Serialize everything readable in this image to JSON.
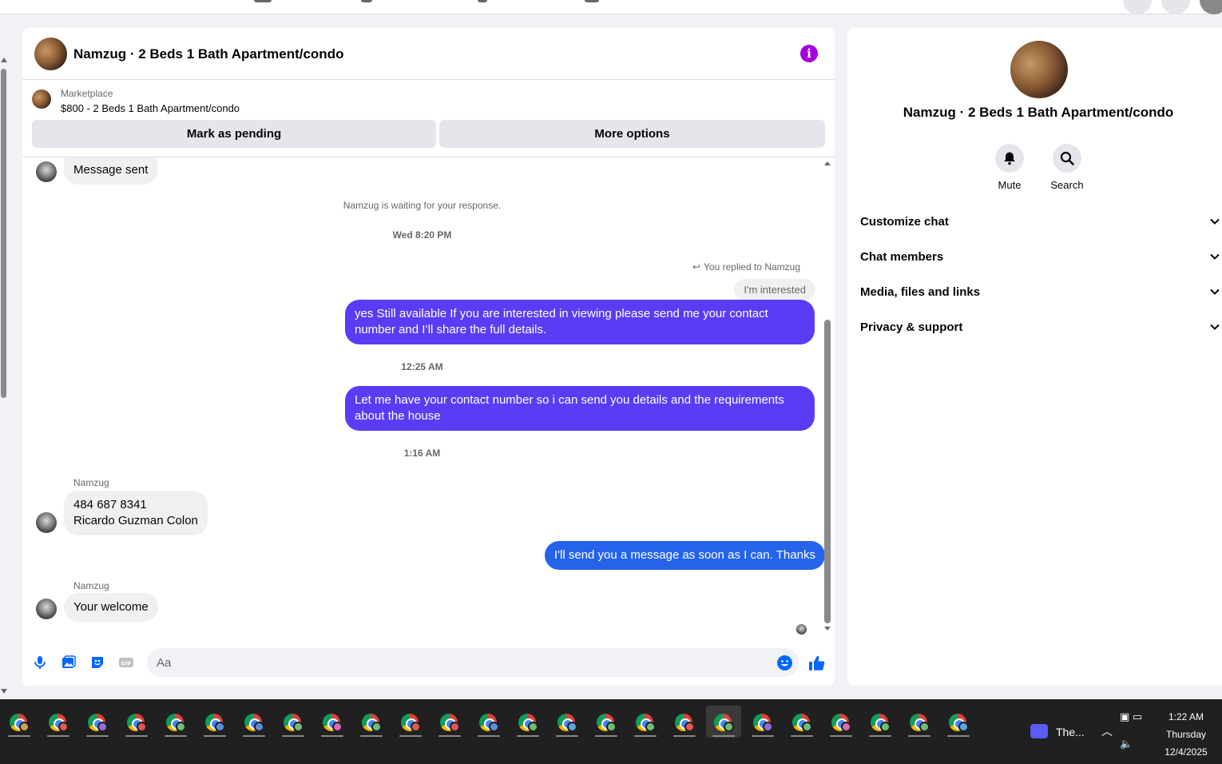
{
  "header": {
    "title": "Namzug · 2 Beds 1 Bath Apartment/condo"
  },
  "marketplace": {
    "label": "Marketplace",
    "price_line": "$800 - 2 Beds 1 Bath Apartment/condo",
    "pending_button": "Mark as pending",
    "more_button": "More options"
  },
  "messages": {
    "first_incoming": "Message sent",
    "waiting_note": "Namzug is waiting for your response.",
    "time1": "Wed 8:20 PM",
    "replied_label": "You replied to Namzug",
    "quoted_text": "I'm interested",
    "out1": "yes Still available If you are interested in viewing please send me your contact number and I’ll share the full details.",
    "time2": "12:25 AM",
    "out2": "Let me have your contact number so i can send you details and the requirements about the house",
    "time3": "1:16 AM",
    "sender1": "Namzug",
    "in_phone": "484 687 8341",
    "in_name": "Ricardo Guzman Colon",
    "out3": "I'll send you a message as soon as I can. Thanks",
    "sender2": "Namzug",
    "in_last": "Your welcome"
  },
  "composer": {
    "placeholder": "Aa",
    "icons": [
      "microphone-icon",
      "photo-icon",
      "sticker-icon",
      "gif-icon",
      "emoji-icon",
      "thumbs-up-icon"
    ]
  },
  "details": {
    "name": "Namzug · 2 Beds 1 Bath Apartment/condo",
    "mute_label": "Mute",
    "search_label": "Search",
    "sections": [
      "Customize chat",
      "Chat members",
      "Media, files and links",
      "Privacy & support"
    ]
  },
  "taskbar": {
    "zoom_label": "The...",
    "time": "1:22 AM",
    "day": "Thursday",
    "date": "12/4/2025"
  },
  "colors": {
    "accent_purple": "#5b3cf5",
    "accent_blue": "#2563eb",
    "messenger_blue": "#0866ff",
    "info_purple": "#a300e0"
  }
}
